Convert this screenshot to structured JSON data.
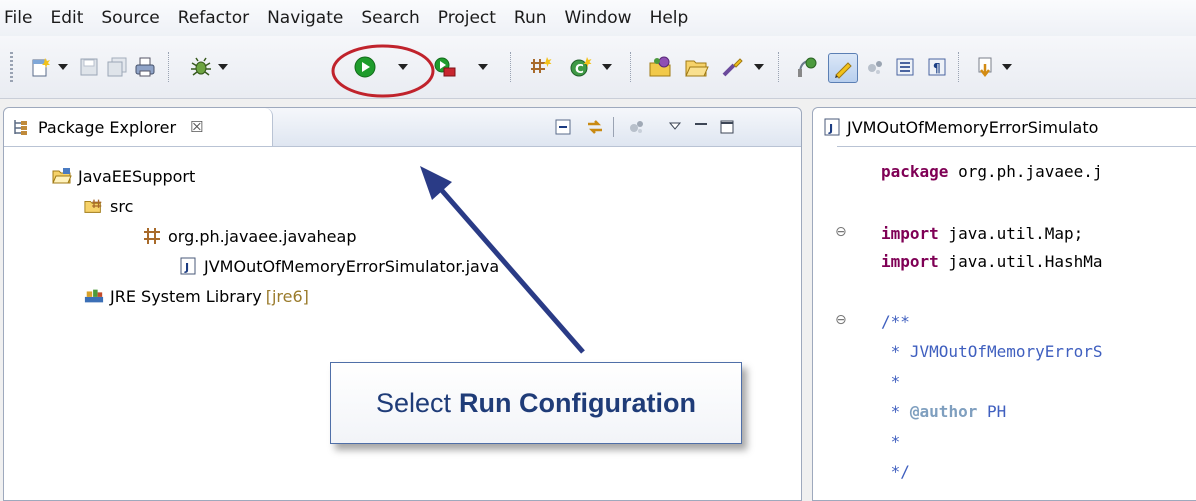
{
  "menu": [
    "File",
    "Edit",
    "Source",
    "Refactor",
    "Navigate",
    "Search",
    "Project",
    "Run",
    "Window",
    "Help"
  ],
  "toolbar": {
    "icons": [
      "new-wizard-icon",
      "save-icon",
      "save-all-icon",
      "print-icon",
      "debug-icon",
      "run-icon",
      "external-tools-icon",
      "new-package-icon",
      "new-class-icon",
      "open-type-icon",
      "open-folder-icon",
      "search-icon",
      "annotation-icon",
      "mark-occurrences-icon",
      "block-selection-icon",
      "show-whitespace-icon",
      "pilcrow-icon",
      "next-annotation-icon"
    ]
  },
  "package_explorer": {
    "tab_label": "Package Explorer",
    "close_glyph": "☒",
    "tree": {
      "project": "JavaEESupport",
      "src": "src",
      "package": "org.ph.javaee.javaheap",
      "file": "JVMOutOfMemoryErrorSimulator.java",
      "library": "JRE System Library",
      "library_tag": "[jre6]"
    }
  },
  "editor": {
    "tab_label": "JVMOutOfMemoryErrorSimulato",
    "lines": {
      "l1_kw": "package",
      "l1_rest": " org.ph.javaee.j",
      "l2_kw": "import",
      "l2_rest": " java.util.Map;",
      "l3_kw": "import",
      "l3_rest": " java.util.HashMa",
      "l4": "/**",
      "l5": " * JVMOutOfMemoryErrorS",
      "l6": " *",
      "l7_pre": " * ",
      "l7_tag": "@author",
      "l7_rest": " PH",
      "l8": " *",
      "l9": " */"
    }
  },
  "callout": {
    "prefix": "Select",
    "bold": "Run Configuration"
  },
  "colors": {
    "highlight_circle": "#c0232c",
    "arrow": "#2a3b86",
    "run_green": "#1f9c2c"
  }
}
